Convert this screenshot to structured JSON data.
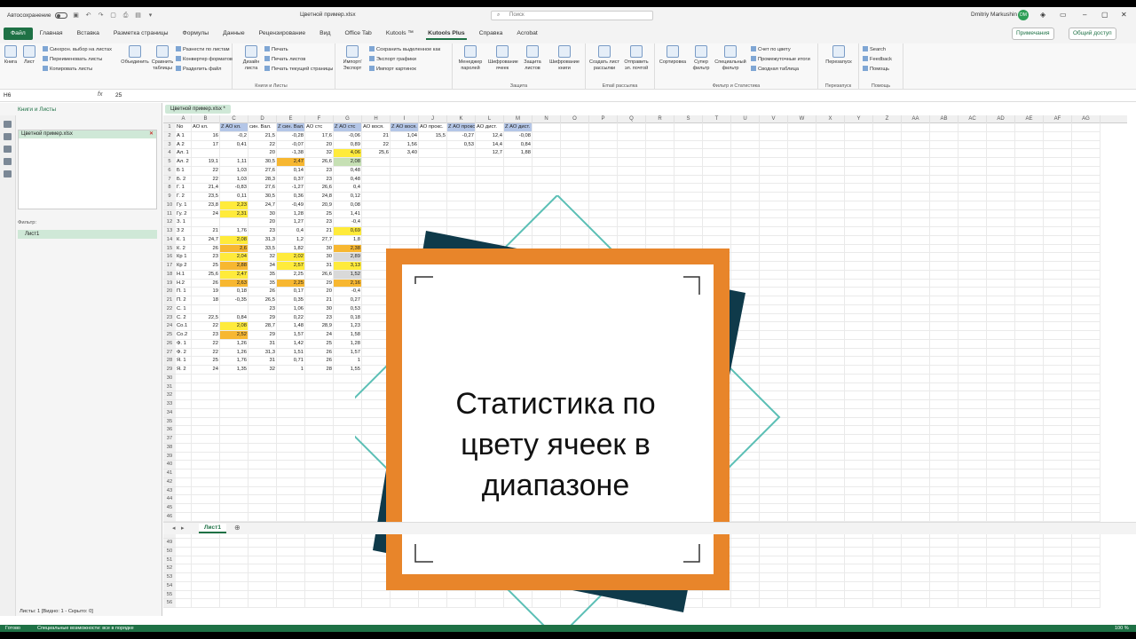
{
  "titlebar": {
    "autosave": "Автосохранение",
    "doc_title": "Цветной пример.xlsx",
    "search_placeholder": "Поиск",
    "user": "Dmitriy Markushin",
    "avatar": "DM"
  },
  "tabs": [
    "Файл",
    "Главная",
    "Вставка",
    "Разметка страницы",
    "Формулы",
    "Данные",
    "Рецензирование",
    "Вид",
    "Office Tab",
    "Kutools ™",
    "Kutools Plus",
    "Справка",
    "Acrobat"
  ],
  "buttons": {
    "notes": "Примечания",
    "share": "Общий доступ"
  },
  "ribbon": {
    "g1_big": [
      "Книга",
      "Лист",
      "Объединить",
      "Сравнить таблицы"
    ],
    "g1_small": [
      "Синхрон. выбор на листах",
      "Переименовать листы",
      "Копировать листы"
    ],
    "g1b_small": [
      "Разнести по листам",
      "Конвертер форматов",
      "Разделить файл"
    ],
    "g1_label": "Книги и Листы",
    "g2_big": [
      "Дизайн листа"
    ],
    "g2_small": [
      "Печать",
      "Печать листов",
      "Печать текущей страницы"
    ],
    "g3_big": [
      "Импорт/ Экспорт"
    ],
    "g3_small": [
      "Сохранить выделенное как",
      "Экспорт графики",
      "Импорт картинок"
    ],
    "g4_big": [
      "Менеджер паролей",
      "Шифрование ячеек",
      "Защита листов",
      "Шифрование книги"
    ],
    "g4_label": "Защита",
    "g5_big": [
      "Создать лист рассылки",
      "Отправить эл. почтой"
    ],
    "g5_label": "Email рассылка",
    "g6_big": [
      "Сортировка",
      "Супер фильтр",
      "Специальный фильтр"
    ],
    "g6_small": [
      "Счет по цвету",
      "Промежуточные итоги",
      "Сводная таблица"
    ],
    "g6_label": "Фильтр и Статистика",
    "g7_big": [
      "Перезапуск"
    ],
    "g7_label": "Перезапуск",
    "g8_small": [
      "Search",
      "Feedback",
      "Помощь"
    ],
    "g8_label": "Помощь"
  },
  "formula": {
    "namebox": "H6",
    "fx": "fx",
    "value": "25"
  },
  "sidebar": {
    "title": "Книги и Листы",
    "book": "Цветной пример.xlsx",
    "filter": "Фильтр:",
    "sheet": "Лист1",
    "status": "Листы: 1  [Видно: 1 - Скрыто: 0]",
    "tab_label": "Цветной пример.xlsx *"
  },
  "columns": [
    "A",
    "B",
    "C",
    "D",
    "E",
    "F",
    "G",
    "H",
    "I",
    "J",
    "K",
    "L",
    "M",
    "N",
    "O",
    "P",
    "Q",
    "R",
    "S",
    "T",
    "U",
    "V",
    "W",
    "X",
    "Y",
    "Z",
    "AA",
    "AB",
    "AC",
    "AD",
    "AE",
    "AF",
    "AG"
  ],
  "header_row": [
    "No",
    "АО кл.",
    "Z АО кл.",
    "син. Вал.",
    "Z син. Вал.",
    "АО стс",
    "Z АО стс",
    "АО вося.",
    "Z АО вося.",
    "АО прокс.",
    "Z АО прокс.",
    "АО дист.",
    "Z АО дист."
  ],
  "rows": [
    [
      "А 1",
      "16",
      "-0,2",
      "21,5",
      "-0,28",
      "17,6",
      "-0,06",
      "21",
      "1,04",
      "15,5",
      "-0,27",
      "12,4",
      "-0,08"
    ],
    [
      "А 2",
      "17",
      "0,41",
      "22",
      "-0,07",
      "20",
      "0,89",
      "22",
      "1,56",
      "",
      "0,53",
      "14,4",
      "0,84"
    ],
    [
      "Ал. 1",
      "",
      "",
      "20",
      "-1,38",
      "32",
      "4,06",
      "25,6",
      "3,40",
      "",
      "",
      "12,7",
      "1,88"
    ],
    [
      "Ал. 2",
      "19,1",
      "1,11",
      "30,5",
      "2,47",
      "26,6",
      "2,08",
      "",
      "",
      "",
      "",
      "",
      ""
    ],
    [
      "Б 1",
      "22",
      "1,03",
      "27,6",
      "0,14",
      "23",
      "0,48",
      "",
      "",
      "",
      "",
      "",
      ""
    ],
    [
      "Б. 2",
      "22",
      "1,03",
      "28,3",
      "0,37",
      "23",
      "0,48",
      "",
      "",
      "",
      "",
      "",
      ""
    ],
    [
      "Г. 1",
      "21,4",
      "-0,83",
      "27,6",
      "-1,27",
      "26,6",
      "0,4",
      "",
      "",
      "",
      "",
      "",
      ""
    ],
    [
      "Г. 2",
      "23,5",
      "0,11",
      "30,5",
      "0,36",
      "24,8",
      "0,12",
      "",
      "",
      "",
      "",
      "",
      ""
    ],
    [
      "Гу. 1",
      "23,8",
      "2,23",
      "24,7",
      "-0,49",
      "20,9",
      "0,08",
      "",
      "",
      "",
      "",
      "",
      ""
    ],
    [
      "Гу. 2",
      "24",
      "2,31",
      "30",
      "1,28",
      "25",
      "1,41",
      "",
      "",
      "",
      "",
      "",
      ""
    ],
    [
      "З. 1",
      "",
      "",
      "20",
      "1,27",
      "23",
      "-0,4",
      "",
      "",
      "",
      "",
      "",
      ""
    ],
    [
      "З 2",
      "21",
      "1,76",
      "23",
      "0,4",
      "21",
      "0,69",
      "",
      "",
      "",
      "",
      "",
      ""
    ],
    [
      "К. 1",
      "24,7",
      "2,08",
      "31,3",
      "1,2",
      "27,7",
      "1,8",
      "",
      "",
      "",
      "",
      "",
      ""
    ],
    [
      "К. 2",
      "26",
      "2,6",
      "33,5",
      "1,82",
      "30",
      "2,38",
      "",
      "",
      "",
      "",
      "",
      ""
    ],
    [
      "Кр 1",
      "23",
      "2,04",
      "32",
      "2,02",
      "30",
      "2,89",
      "",
      "",
      "",
      "",
      "",
      ""
    ],
    [
      "Кр 2",
      "25",
      "2,88",
      "34",
      "2,57",
      "31",
      "3,13",
      "",
      "",
      "",
      "",
      "",
      ""
    ],
    [
      "Н.1",
      "25,6",
      "2,47",
      "35",
      "2,25",
      "26,6",
      "1,52",
      "",
      "",
      "",
      "",
      "",
      ""
    ],
    [
      "Н.2",
      "26",
      "2,63",
      "35",
      "2,25",
      "29",
      "2,16",
      "",
      "",
      "",
      "",
      "",
      ""
    ],
    [
      "П. 1",
      "19",
      "0,18",
      "26",
      "0,17",
      "20",
      "-0,4",
      "",
      "",
      "",
      "",
      "",
      ""
    ],
    [
      "П. 2",
      "18",
      "-0,35",
      "26,5",
      "0,35",
      "21",
      "0,27",
      "",
      "",
      "",
      "",
      "",
      ""
    ],
    [
      "С. 1",
      "",
      "",
      "23",
      "1,06",
      "30",
      "0,53",
      "",
      "",
      "",
      "",
      "",
      ""
    ],
    [
      "С. 2",
      "22,5",
      "0,84",
      "29",
      "0,22",
      "23",
      "0,18",
      "",
      "",
      "",
      "",
      "",
      ""
    ],
    [
      "Со.1",
      "22",
      "2,08",
      "28,7",
      "1,48",
      "28,9",
      "1,23",
      "",
      "",
      "",
      "",
      "",
      ""
    ],
    [
      "Со.2",
      "23",
      "2,52",
      "29",
      "1,57",
      "24",
      "1,58",
      "",
      "",
      "",
      "",
      "",
      ""
    ],
    [
      "Ф. 1",
      "22",
      "1,26",
      "31",
      "1,42",
      "25",
      "1,28",
      "",
      "",
      "",
      "",
      "",
      ""
    ],
    [
      "Ф. 2",
      "22",
      "1,26",
      "31,3",
      "1,51",
      "26",
      "1,57",
      "",
      "",
      "",
      "",
      "",
      ""
    ],
    [
      "Я. 1",
      "25",
      "1,76",
      "31",
      "0,71",
      "26",
      "1",
      "",
      "",
      "",
      "",
      "",
      ""
    ],
    [
      "Я. 2",
      "24",
      "1,35",
      "32",
      "1",
      "28",
      "1,55",
      "",
      "",
      "",
      "",
      "",
      ""
    ]
  ],
  "highlights": {
    "yellow": [
      "3-6",
      "9-2",
      "10-2",
      "13-2",
      "15-2",
      "16-4",
      "17-2",
      "23-2",
      "12-6",
      "15-4",
      "16-6"
    ],
    "orange": [
      "4-4",
      "14-2",
      "16-2",
      "18-2",
      "18-4",
      "24-2",
      "14-6",
      "18-6"
    ],
    "green": [
      "4-6"
    ],
    "grey": [
      "15-6",
      "17-6"
    ]
  },
  "overlay": {
    "text_line1": "Статистика по",
    "text_line2": "цвету ячеек в",
    "text_line3": "диапазоне",
    "colors": {
      "orange": "#e8852a",
      "navy": "#0f3a4a",
      "teal": "#5bbfb5"
    }
  },
  "sheet_tab": "Лист1",
  "status": {
    "ready": "Готово",
    "accessibility": "Специальные возможности: все в порядке",
    "zoom": "100 %"
  }
}
